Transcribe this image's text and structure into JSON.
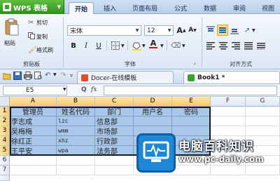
{
  "app": {
    "name": "WPS 表格"
  },
  "ribbon_tabs": [
    "开始",
    "插入",
    "页面布局",
    "公式",
    "数据",
    "审阅",
    "视图"
  ],
  "clipboard": {
    "paste": "粘贴",
    "cut": "剪切",
    "copy": "复制",
    "format_painter": "格式刷",
    "group": "剪贴板"
  },
  "font": {
    "name": "宋体",
    "size": "12",
    "group": "字体",
    "bold": "B",
    "italic": "I",
    "underline": "U",
    "grow": "A",
    "shrink": "A",
    "color_letter": "A"
  },
  "alignment": {
    "group": "对齐方式"
  },
  "doc_tabs": [
    {
      "label": "Docer-在线模板"
    },
    {
      "label": "Book1 *"
    }
  ],
  "formula_bar": {
    "name_box": "E5",
    "fx": "fx",
    "zoom_icon_glyph": "Q"
  },
  "sheet": {
    "columns": [
      "A",
      "B",
      "C",
      "D",
      "E",
      "F",
      "G"
    ],
    "rows": [
      "1",
      "2",
      "3",
      "4",
      "5",
      "6",
      "7"
    ],
    "header_row": [
      "管理员",
      "姓名代码",
      "部门",
      "用户名",
      "密码"
    ],
    "data_rows": [
      [
        "李志成",
        "lzc",
        "信息部",
        "",
        ""
      ],
      [
        "吴梅梅",
        "wmm",
        "市场部",
        "",
        ""
      ],
      [
        "徐红正",
        "xhz",
        "行政部",
        "",
        ""
      ],
      [
        "王平安",
        "wpa",
        "法务部",
        "",
        ""
      ]
    ]
  },
  "watermark": {
    "title": "电脑百科知识",
    "url": "www.pc-daily.com"
  },
  "colors": {
    "selection": "#a9c7e8",
    "app_green": "#3aa12a",
    "ribbon_blue": "#dce7f5"
  }
}
